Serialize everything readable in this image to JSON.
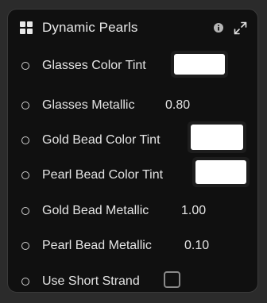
{
  "panel": {
    "title": "Dynamic Pearls",
    "icons": {
      "grid": "grid-icon",
      "info": "info-icon",
      "expand": "expand-icon"
    }
  },
  "properties": [
    {
      "label": "Glasses Color Tint",
      "type": "color",
      "color": "#ffffff"
    },
    {
      "label": "Glasses Metallic",
      "type": "number",
      "value": "0.80"
    },
    {
      "label": "Gold Bead Color Tint",
      "type": "color",
      "color": "#ffffff"
    },
    {
      "label": "Pearl Bead Color Tint",
      "type": "color",
      "color": "#ffffff"
    },
    {
      "label": "Gold Bead Metallic",
      "type": "number",
      "value": "1.00"
    },
    {
      "label": "Pearl Bead Metallic",
      "type": "number",
      "value": "0.10"
    },
    {
      "label": "Use Short Strand",
      "type": "checkbox",
      "checked": false
    }
  ],
  "colors": {
    "panel_bg": "#101010",
    "page_bg": "#2b2b2b",
    "text": "#e4e4e4"
  }
}
